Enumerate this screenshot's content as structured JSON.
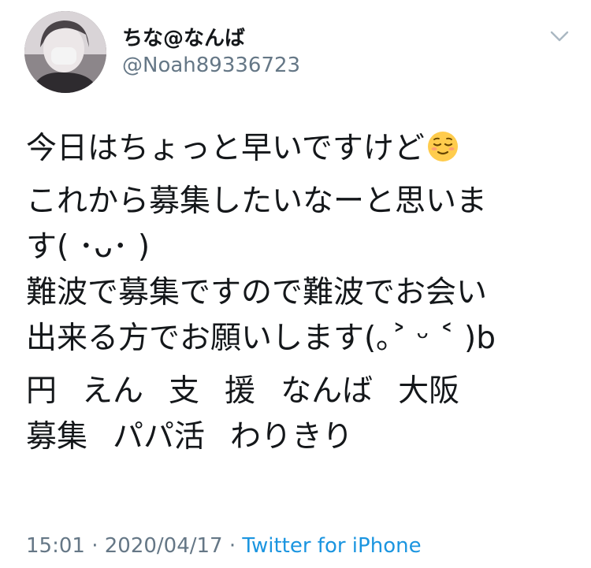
{
  "tweet": {
    "display_name": "ちな@なんば",
    "handle": "@Noah89336723",
    "text_lines": [
      "今日はちょっと早いですけど",
      "これから募集したいなーと思いま",
      "す( ･ᴗ･ )",
      "難波で募集ですので難波でお会い",
      "出来る方でお願いします(｡˃ ᵕ ˂ )b"
    ],
    "tags_row1": [
      "円",
      "えん",
      "支",
      "援",
      "なんば",
      "大阪"
    ],
    "tags_row2": [
      "募集",
      "パパ活",
      "わりきり"
    ],
    "time": "15:01",
    "separator1": " · ",
    "date": "2020/04/17",
    "separator2": " · ",
    "source": "Twitter for iPhone",
    "icons": {
      "menu": "chevron-down-icon",
      "emoji": "relieved-face-emoji"
    },
    "colors": {
      "text": "#14171a",
      "secondary": "#657786",
      "link": "#1b95e0"
    }
  }
}
